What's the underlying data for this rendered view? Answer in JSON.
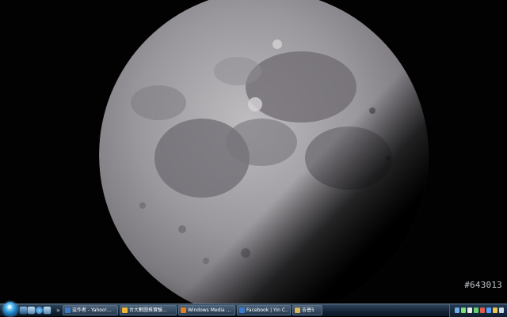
{
  "desktop": {
    "wallpaper": "moon",
    "watermark": "#643013"
  },
  "taskbar": {
    "start_button": "start-orb",
    "quick_launch": [
      "show-desktop-icon",
      "switch-windows-icon",
      "ie-icon",
      "folder-icon"
    ],
    "overflow": "»",
    "tasks": [
      {
        "label": "這作者 - Yahoo!...",
        "icon": "ie-icon",
        "color": "#3b79c9"
      },
      {
        "label": "台大數圖推實驗...",
        "icon": "msn-icon",
        "color": "#f2b631"
      },
      {
        "label": "Windows Media ...",
        "icon": "media-player-icon",
        "color": "#e57c22"
      },
      {
        "label": "Facebook | Yin C...",
        "icon": "ie-icon",
        "color": "#3b79c9"
      },
      {
        "label": "吉普5",
        "icon": "folder-icon",
        "color": "#d8b65a"
      }
    ],
    "tray_icons": [
      {
        "name": "network-icon",
        "color": "#6fb0e6"
      },
      {
        "name": "security-icon",
        "color": "#7fe07a"
      },
      {
        "name": "volume-icon",
        "color": "#e8e8e8"
      },
      {
        "name": "messenger-icon",
        "color": "#65d26e"
      },
      {
        "name": "antivirus-icon",
        "color": "#e35a4e"
      },
      {
        "name": "update-icon",
        "color": "#5aa0ff"
      },
      {
        "name": "input-method-icon",
        "color": "#f0c850"
      },
      {
        "name": "battery-icon",
        "color": "#c8d8e8"
      }
    ]
  }
}
